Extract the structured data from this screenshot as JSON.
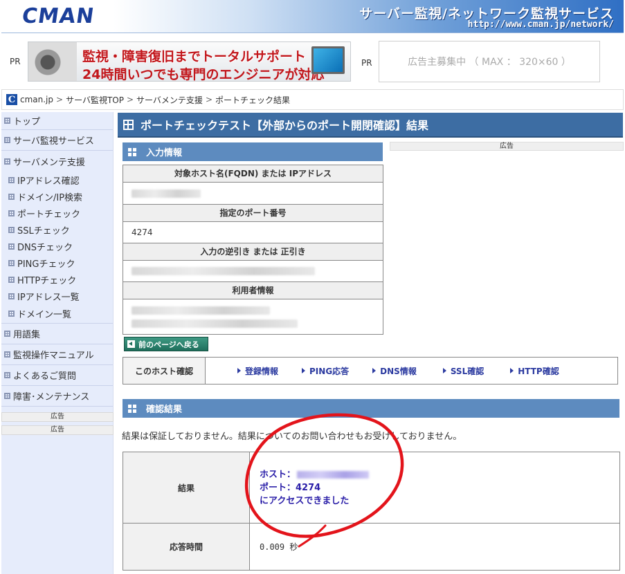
{
  "header": {
    "logo": "CMAN",
    "tagline": "サーバー監視/ネットワーク監視サービス",
    "url": "http://www.cman.jp/network/"
  },
  "pr": {
    "label_left": "PR",
    "label_right": "PR",
    "banner_line1": "監視・障害復旧までトータルサポート",
    "banner_line2": "24時間いつでも専門のエンジニアが対応",
    "ad_placeholder": "広告主募集中 （ MAX ： 320×60 ）"
  },
  "breadcrumb": {
    "icon": "C",
    "items": [
      "cman.jp",
      "サーバ監視TOP",
      "サーバメンテ支援",
      "ポートチェック結果"
    ],
    "separator": ">"
  },
  "sidebar": {
    "items": [
      {
        "label": "トップ",
        "level": "main"
      },
      {
        "label": "サーバ監視サービス",
        "level": "main"
      },
      {
        "label": "サーバメンテ支援",
        "level": "main"
      },
      {
        "label": "IPアドレス確認",
        "level": "sub"
      },
      {
        "label": "ドメイン/IP検索",
        "level": "sub"
      },
      {
        "label": "ポートチェック",
        "level": "sub"
      },
      {
        "label": "SSLチェック",
        "level": "sub"
      },
      {
        "label": "DNSチェック",
        "level": "sub"
      },
      {
        "label": "PINGチェック",
        "level": "sub"
      },
      {
        "label": "HTTPチェック",
        "level": "sub"
      },
      {
        "label": "IPアドレス一覧",
        "level": "sub"
      },
      {
        "label": "ドメイン一覧",
        "level": "sub"
      },
      {
        "label": "用語集",
        "level": "main"
      },
      {
        "label": "監視操作マニュアル",
        "level": "main"
      },
      {
        "label": "よくあるご質問",
        "level": "main"
      },
      {
        "label": "障害･メンテナンス",
        "level": "main"
      }
    ],
    "ad1": "広告",
    "ad2": "広告"
  },
  "main": {
    "title": "ポートチェックテスト【外部からのポート開閉確認】結果",
    "ad_label": "広告",
    "input_section": {
      "heading": "入力情報",
      "host_label": "対象ホスト名(FQDN) または IPアドレス",
      "port_label": "指定のポート番号",
      "port_value": "4274",
      "lookup_label": "入力の逆引き または 正引き",
      "user_label": "利用者情報"
    },
    "back_button": "前のページへ戻る",
    "host_check": {
      "label": "このホスト確認",
      "links": [
        "登録情報",
        "PING応答",
        "DNS情報",
        "SSL確認",
        "HTTP確認"
      ]
    },
    "result_section": {
      "heading": "確認結果",
      "note": "結果は保証しておりません。結果についてのお問い合わせもお受けしておりません。",
      "result_label": "結果",
      "host_prefix": "ホスト：",
      "port_line": "ポート：4274",
      "access_line": "にアクセスできました",
      "response_label": "応答時間",
      "response_value": "0.009 秒"
    }
  },
  "colors": {
    "title_bar": "#3d6da3",
    "section_head": "#5d8bbf",
    "sidebar_bg": "#e6ecfb",
    "result_text": "#2a1ea8",
    "annotation": "#e3141b"
  }
}
